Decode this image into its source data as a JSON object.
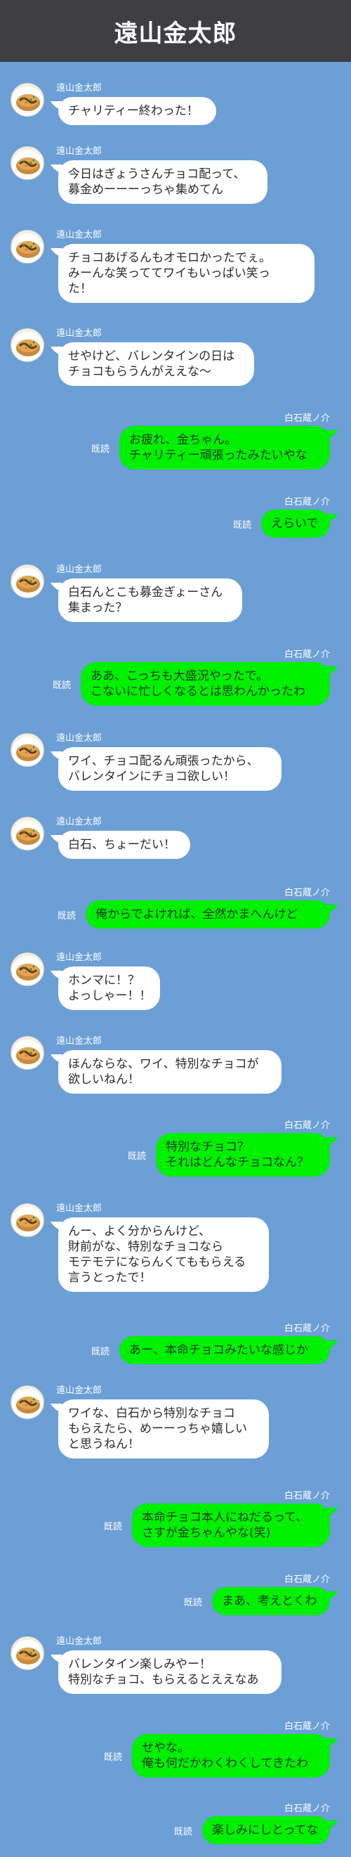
{
  "header": {
    "title": "遠山金太郎"
  },
  "avatar_icon": "takoyaki-icon",
  "colors": {
    "background": "#6b9fd6",
    "header": "#3e3e43",
    "self_bubble": "#00f000",
    "other_bubble": "#ffffff"
  },
  "messages": [
    {
      "side": "left",
      "sender": "遠山金太郎",
      "lines": [
        "チャリティー終わった！"
      ]
    },
    {
      "side": "left",
      "sender": "遠山金太郎",
      "lines": [
        "今日はぎょうさんチョコ配って、",
        "募金めーーーっちゃ集めてん"
      ]
    },
    {
      "side": "left",
      "sender": "遠山金太郎",
      "lines": [
        "チョコあげるんもオモロかったでぇ。",
        "みーんな笑っててワイもいっぱい笑っ",
        "た！"
      ]
    },
    {
      "side": "left",
      "sender": "遠山金太郎",
      "lines": [
        "せやけど、バレンタインの日は",
        "チョコもらうんがええな〜"
      ]
    },
    {
      "side": "right",
      "sender": "白石蔵ノ介",
      "read": "既読",
      "lines": [
        "お疲れ、金ちゃん。",
        "チャリティー頑張ったみたいやな"
      ]
    },
    {
      "side": "right",
      "sender": "白石蔵ノ介",
      "read": "既読",
      "lines": [
        "えらいで"
      ]
    },
    {
      "side": "left",
      "sender": "遠山金太郎",
      "lines": [
        "白石んとこも募金ぎょーさん",
        "集まった？"
      ]
    },
    {
      "side": "right",
      "sender": "白石蔵ノ介",
      "read": "既読",
      "lines": [
        "ああ、こっちも大盛況やったで。",
        "こないに忙しくなるとは思わんかったわ"
      ]
    },
    {
      "side": "left",
      "sender": "遠山金太郎",
      "lines": [
        "ワイ、チョコ配るん頑張ったから、",
        "バレンタインにチョコ欲しい！"
      ]
    },
    {
      "side": "left",
      "sender": "遠山金太郎",
      "lines": [
        "白石、ちょーだい！"
      ]
    },
    {
      "side": "right",
      "sender": "白石蔵ノ介",
      "read": "既読",
      "lines": [
        "俺からでよければ、全然かまへんけど"
      ]
    },
    {
      "side": "left",
      "sender": "遠山金太郎",
      "lines": [
        "ホンマに！？",
        "よっしゃー！！"
      ]
    },
    {
      "side": "left",
      "sender": "遠山金太郎",
      "lines": [
        "ほんならな、ワイ、特別なチョコが",
        "欲しいねん！"
      ]
    },
    {
      "side": "right",
      "sender": "白石蔵ノ介",
      "read": "既読",
      "lines": [
        "特別なチョコ？",
        "それはどんなチョコなん？"
      ]
    },
    {
      "side": "left",
      "sender": "遠山金太郎",
      "lines": [
        "んー、よく分からんけど、",
        "財前がな、特別なチョコなら",
        "モテモテにならんくてももらえる",
        "言うとったで！"
      ]
    },
    {
      "side": "right",
      "sender": "白石蔵ノ介",
      "read": "既読",
      "lines": [
        "あー、本命チョコみたいな感じか"
      ]
    },
    {
      "side": "left",
      "sender": "遠山金太郎",
      "lines": [
        "ワイな、白石から特別なチョコ",
        "もらえたら、めーーっちゃ嬉しい",
        "と思うねん！"
      ]
    },
    {
      "side": "right",
      "sender": "白石蔵ノ介",
      "read": "既読",
      "lines": [
        "本命チョコ本人にねだるって、",
        "さすが金ちゃんやな(笑)"
      ]
    },
    {
      "side": "right",
      "sender": "白石蔵ノ介",
      "read": "既読",
      "lines": [
        "まあ、考えとくわ"
      ]
    },
    {
      "side": "left",
      "sender": "遠山金太郎",
      "lines": [
        "バレンタイン楽しみやー！",
        "特別なチョコ、もらえるとええなあ"
      ]
    },
    {
      "side": "right",
      "sender": "白石蔵ノ介",
      "read": "既読",
      "lines": [
        "せやな。",
        "俺も何だかわくわくしてきたわ"
      ]
    },
    {
      "side": "right",
      "sender": "白石蔵ノ介",
      "read": "既読",
      "lines": [
        "楽しみにしとってな"
      ]
    }
  ]
}
